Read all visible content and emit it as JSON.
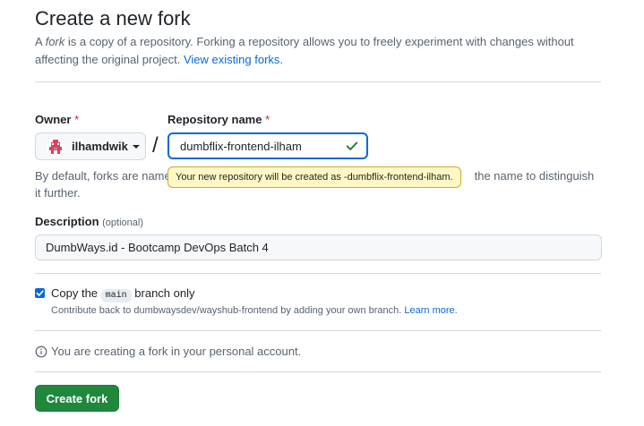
{
  "page": {
    "title": "Create a new fork",
    "intro_a": "A ",
    "intro_em": "fork",
    "intro_b": " is a copy of a repository. Forking a repository allows you to freely experiment with changes without affecting the original project. ",
    "intro_link": "View existing forks."
  },
  "owner": {
    "label": "Owner",
    "required_mark": "*",
    "value": "ilhamdwik",
    "avatar_icon": "user-avatar-icon",
    "caret_icon": "chevron-down-icon"
  },
  "separator": "/",
  "repo": {
    "label": "Repository name",
    "required_mark": "*",
    "value": "dumbflix-frontend-ilham",
    "valid_icon": "check-icon",
    "hint_start": "By default, forks are named",
    "hint_end": " the name to distinguish it further.",
    "tooltip": "Your new repository will be created as -dumbflix-frontend-ilham."
  },
  "description": {
    "label": "Description",
    "optional": "(optional)",
    "value": "DumbWays.id - Bootcamp DevOps Batch 4"
  },
  "copy_branch": {
    "checked": true,
    "label_before": "Copy the ",
    "branch": "main",
    "label_after": " branch only",
    "subtext": "Contribute back to dumbwaysdev/wayshub-frontend by adding your own branch. ",
    "learn_more": "Learn more."
  },
  "info": {
    "icon": "info-icon",
    "text": "You are creating a fork in your personal account."
  },
  "submit": {
    "label": "Create fork"
  },
  "colors": {
    "accent": "#0969da",
    "primary_button": "#1f883d",
    "required": "#d1242f",
    "valid": "#1a7f37",
    "tooltip_bg": "#fff8c5"
  }
}
